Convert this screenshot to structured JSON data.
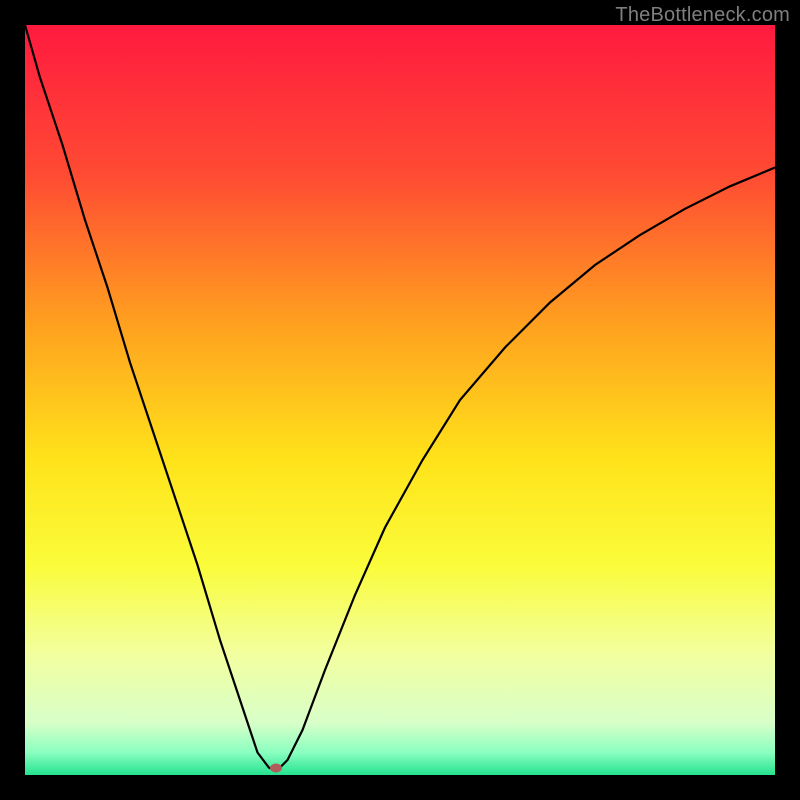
{
  "watermark": "TheBottleneck.com",
  "gradient": {
    "stops": [
      {
        "pct": 0,
        "color": "#ff1a3f"
      },
      {
        "pct": 20,
        "color": "#ff4b33"
      },
      {
        "pct": 40,
        "color": "#ffa11f"
      },
      {
        "pct": 58,
        "color": "#ffe31a"
      },
      {
        "pct": 72,
        "color": "#fafc3a"
      },
      {
        "pct": 84,
        "color": "#f2ffa0"
      },
      {
        "pct": 93,
        "color": "#d8ffc8"
      },
      {
        "pct": 97,
        "color": "#8affc0"
      },
      {
        "pct": 100,
        "color": "#24e28e"
      }
    ]
  },
  "marker": {
    "x_pct": 33.5,
    "y_pct": 99.0,
    "color": "#b25b5b"
  },
  "chart_data": {
    "type": "line",
    "title": "",
    "xlabel": "",
    "ylabel": "",
    "x": [
      0,
      2,
      5,
      8,
      11,
      14,
      17,
      20,
      23,
      26,
      29,
      31,
      32.5,
      33.5,
      35,
      37,
      40,
      44,
      48,
      53,
      58,
      64,
      70,
      76,
      82,
      88,
      94,
      100
    ],
    "values": [
      100,
      93,
      84,
      74,
      65,
      55,
      46,
      37,
      28,
      18,
      9,
      3,
      1,
      0.5,
      2,
      6,
      14,
      24,
      33,
      42,
      50,
      57,
      63,
      68,
      72,
      75.5,
      78.5,
      81
    ],
    "xlim": [
      0,
      100
    ],
    "ylim": [
      0,
      100
    ],
    "minimum_point": {
      "x": 33.5,
      "y": 0.5
    },
    "note": "x and y expressed as percent of plot width/height; y=0 is bottom (green), y=100 is top (red). Curve has a V/cusp minimum near x≈33.5%."
  }
}
